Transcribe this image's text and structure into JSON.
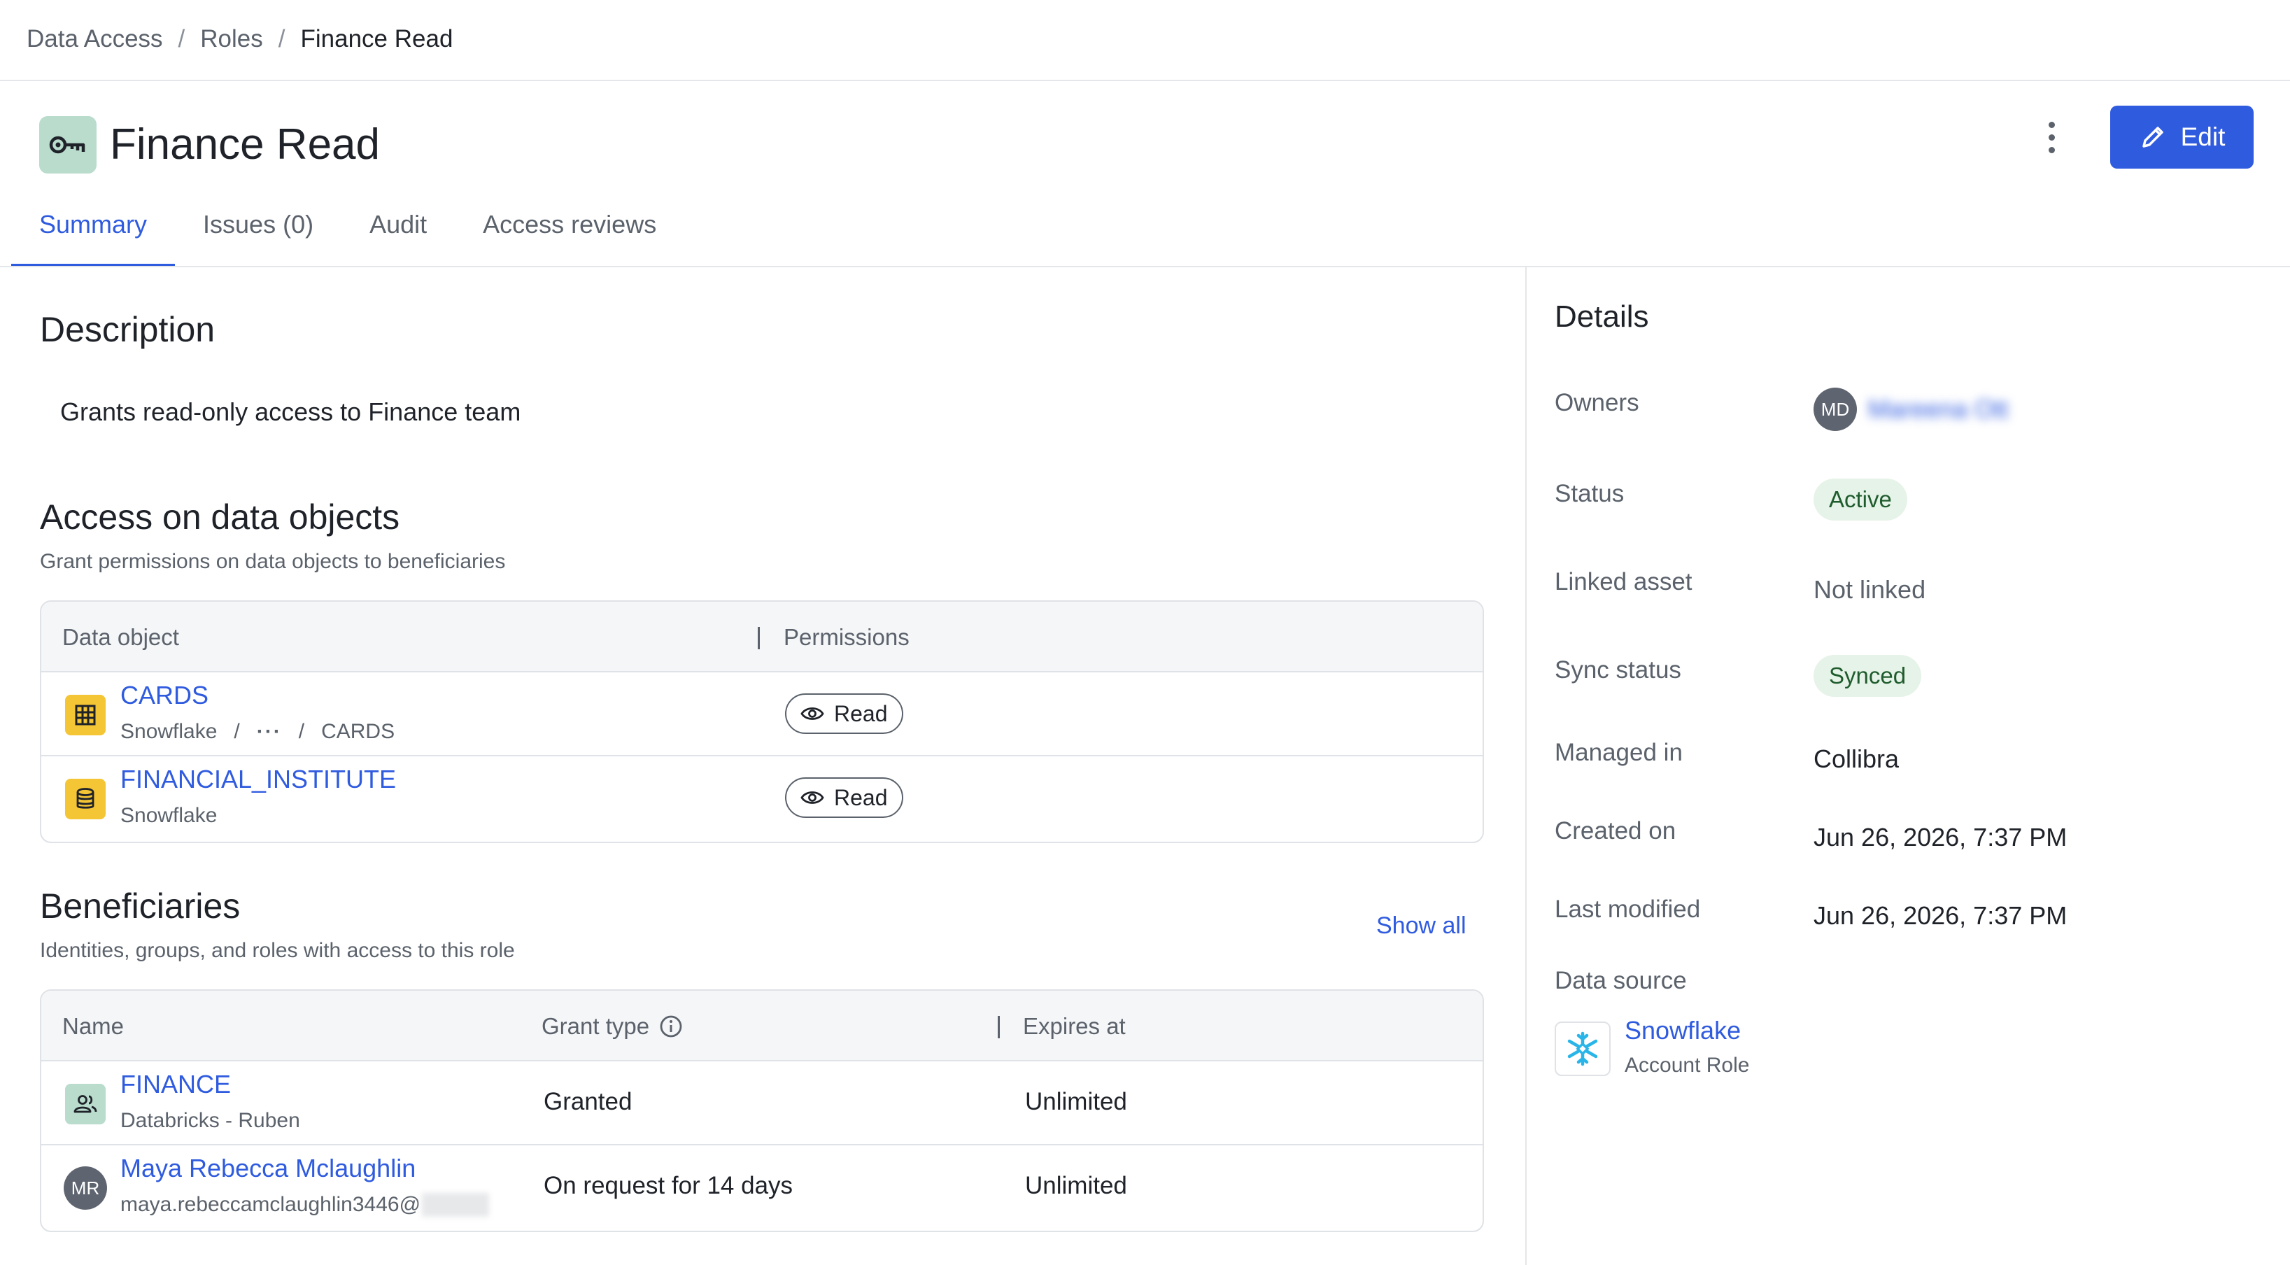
{
  "breadcrumb": [
    "Data Access",
    "Roles",
    "Finance Read"
  ],
  "header": {
    "title": "Finance Read",
    "edit_label": "Edit",
    "icon": "key-icon"
  },
  "tabs": [
    {
      "label": "Summary",
      "active": true
    },
    {
      "label": "Issues (0)",
      "active": false
    },
    {
      "label": "Audit",
      "active": false
    },
    {
      "label": "Access reviews",
      "active": false
    }
  ],
  "description": {
    "heading": "Description",
    "text": "Grants read-only access to Finance team"
  },
  "access": {
    "heading": "Access on data objects",
    "subtitle": "Grant permissions on data objects to beneficiaries",
    "columns": [
      "Data object",
      "Permissions"
    ],
    "rows": [
      {
        "name": "CARDS",
        "path": [
          "Snowflake",
          "CARDS"
        ],
        "permission": "Read",
        "icon": "table-icon"
      },
      {
        "name": "FINANCIAL_INSTITUTE",
        "source": "Snowflake",
        "permission": "Read",
        "icon": "database-icon"
      }
    ]
  },
  "beneficiaries": {
    "heading": "Beneficiaries",
    "subtitle": "Identities, groups, and roles with access to this role",
    "show_all": "Show all",
    "columns": [
      "Name",
      "Grant type",
      "Expires at"
    ],
    "rows": [
      {
        "name": "FINANCE",
        "sub": "Databricks - Ruben",
        "grant": "Granted",
        "expires": "Unlimited",
        "icon": "group-icon"
      },
      {
        "name": "Maya Rebecca Mclaughlin",
        "sub": "maya.rebeccamclaughlin3446@",
        "grant": "On request for 14 days",
        "expires": "Unlimited",
        "initials": "MR"
      }
    ]
  },
  "details": {
    "heading": "Details",
    "owners_label": "Owners",
    "owner_initials": "MD",
    "owner_name": "Mareena Ott",
    "status_label": "Status",
    "status_value": "Active",
    "linked_label": "Linked asset",
    "linked_value": "Not linked",
    "sync_label": "Sync status",
    "sync_value": "Synced",
    "managed_label": "Managed in",
    "managed_value": "Collibra",
    "created_label": "Created on",
    "created_value": "Jun 26, 2026, 7:37 PM",
    "modified_label": "Last modified",
    "modified_value": "Jun 26, 2026, 7:37 PM",
    "source_label": "Data source",
    "source_name": "Snowflake",
    "source_type": "Account Role"
  },
  "colors": {
    "accent": "#2f5bdf",
    "role_icon_bg": "#b9dccd",
    "object_icon_bg": "#f4c534",
    "badge_bg": "#e6f3e8"
  }
}
